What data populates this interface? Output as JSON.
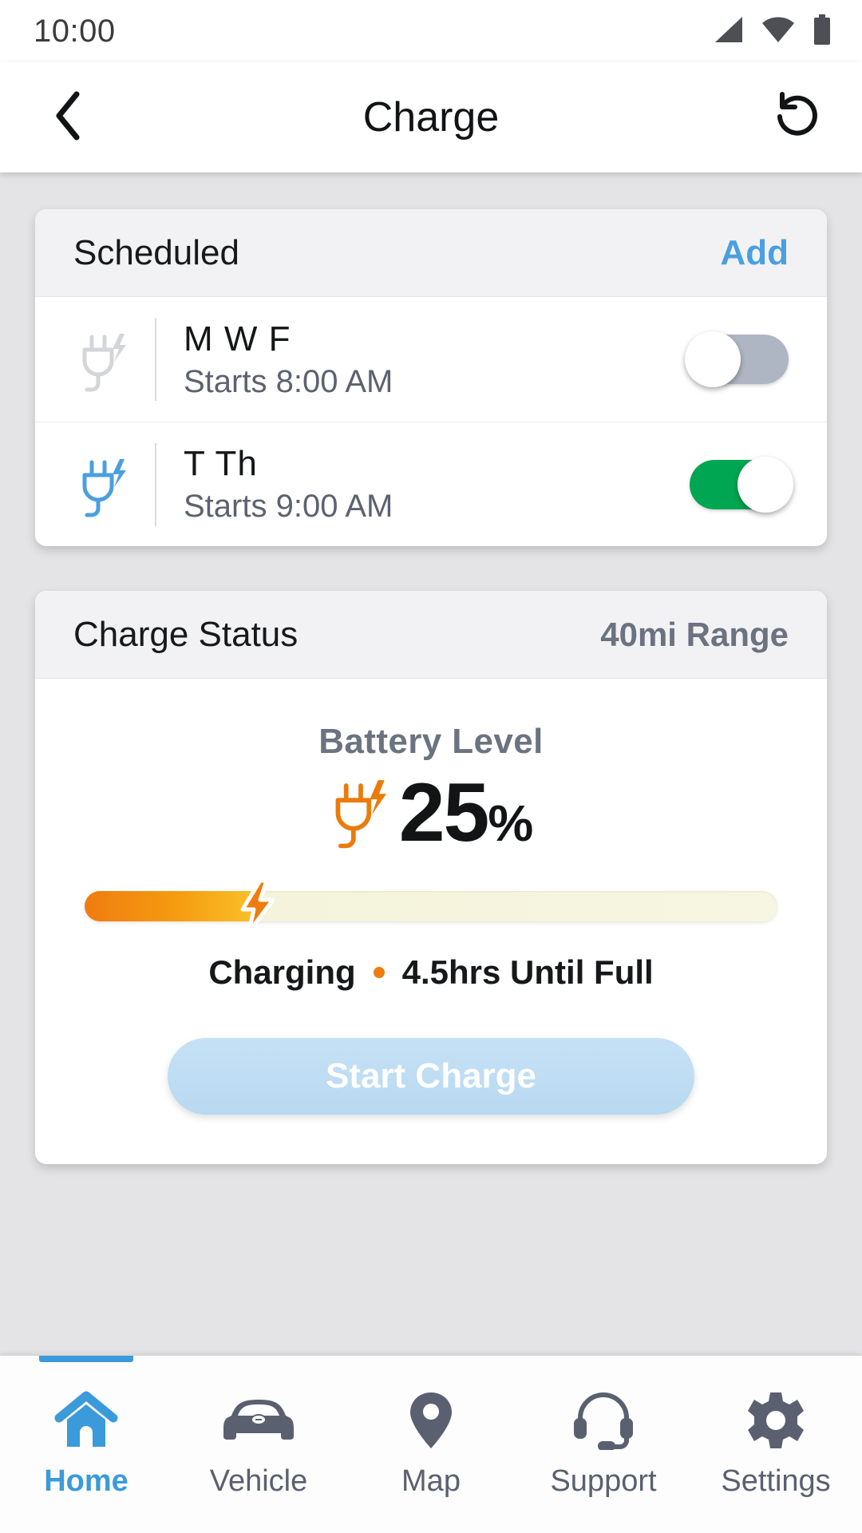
{
  "status_bar": {
    "time": "10:00",
    "icons": [
      "signal-icon",
      "wifi-icon",
      "battery-icon"
    ]
  },
  "header": {
    "back_icon": "chevron-left-icon",
    "title": "Charge",
    "refresh_icon": "refresh-counterclockwise-icon"
  },
  "scheduled_card": {
    "title": "Scheduled",
    "add_label": "Add",
    "rows": [
      {
        "icon": "plug-charge-icon",
        "icon_state": "inactive",
        "days": "M W F",
        "time": "Starts 8:00 AM",
        "toggle_on": false
      },
      {
        "icon": "plug-charge-icon",
        "icon_state": "active",
        "days": "T Th",
        "time": "Starts 9:00 AM",
        "toggle_on": true
      }
    ]
  },
  "charge_status_card": {
    "title": "Charge Status",
    "range": "40mi Range",
    "battery_label": "Battery Level",
    "plug_icon": "plug-charge-icon",
    "battery_value": "25",
    "battery_symbol": "%",
    "battery_percent": 25,
    "bolt_icon": "lightning-bolt-icon",
    "charging_state": "Charging",
    "time_remaining": "4.5hrs Until Full",
    "start_button": "Start Charge"
  },
  "bottom_nav": [
    {
      "label": "Home",
      "icon": "home-icon",
      "active": true
    },
    {
      "label": "Vehicle",
      "icon": "car-icon",
      "active": false
    },
    {
      "label": "Map",
      "icon": "map-pin-icon",
      "active": false
    },
    {
      "label": "Support",
      "icon": "headset-icon",
      "active": false
    },
    {
      "label": "Settings",
      "icon": "gear-icon",
      "active": false
    }
  ],
  "colors": {
    "accent_blue": "#3b9ad9",
    "link_blue": "#4a9fe0",
    "toggle_on_green": "#00a651",
    "toggle_off_gray": "#aeb5c3",
    "charge_orange": "#ef7c10",
    "page_background": "#e4e4e6",
    "icon_gray": "#5a6070"
  }
}
